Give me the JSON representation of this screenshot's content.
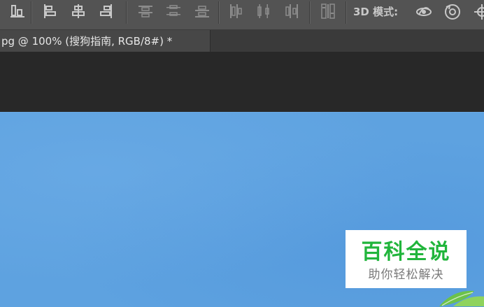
{
  "options_bar": {
    "align_buttons": [
      {
        "icon": "align-bottom-edges-icon"
      },
      {
        "icon": "align-left-edges-icon"
      },
      {
        "icon": "align-horizontal-centers-icon"
      },
      {
        "icon": "align-right-edges-icon"
      },
      {
        "icon": "distribute-top-edges-icon"
      },
      {
        "icon": "distribute-vertical-centers-icon"
      },
      {
        "icon": "distribute-bottom-edges-icon"
      },
      {
        "icon": "distribute-left-edges-icon"
      },
      {
        "icon": "distribute-horizontal-centers-icon"
      },
      {
        "icon": "distribute-right-edges-icon"
      },
      {
        "icon": "auto-align-layers-icon"
      }
    ],
    "mode_label": "3D 模式:",
    "mode_icons": [
      "orbit-3d-icon",
      "roll-3d-icon",
      "pan-3d-icon"
    ],
    "icon_color": "#c8c8c8"
  },
  "document_tab": {
    "title": "pg @ 100% (搜狗指南, RGB/8#) *"
  },
  "canvas": {
    "background_color": "#5ea2e0"
  },
  "watermark": {
    "main_text": "百科全说",
    "sub_text": "助你轻松解决",
    "main_color": "#21b53c"
  }
}
